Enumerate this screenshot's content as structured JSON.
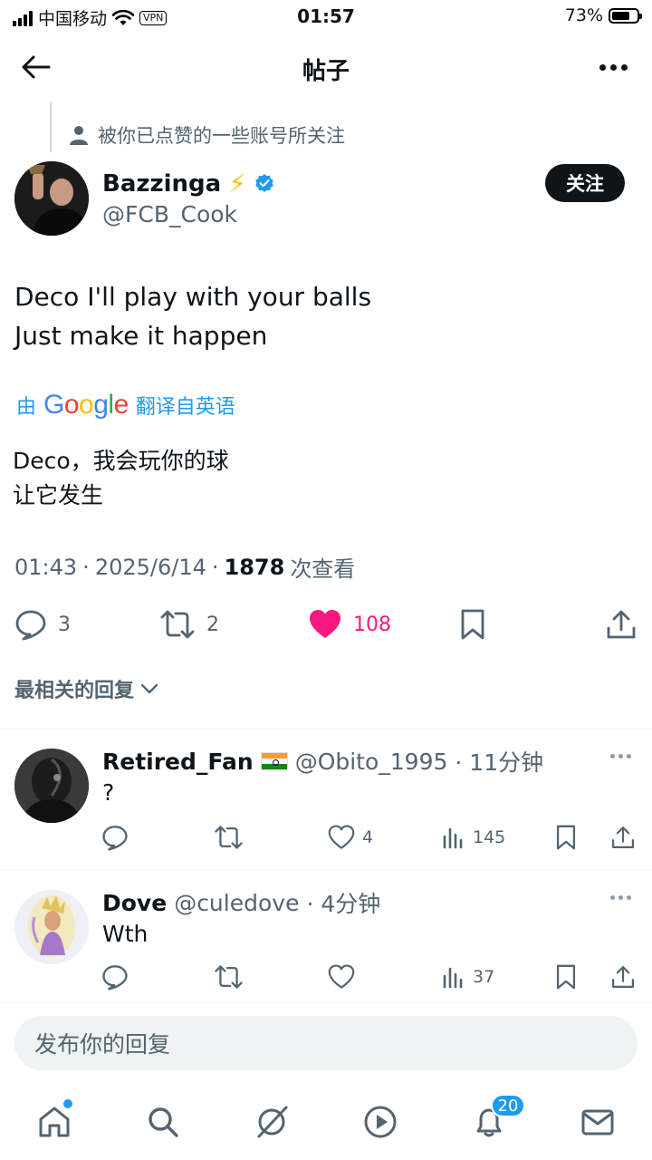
{
  "status_bar": {
    "carrier": "中国移动",
    "vpn": "VPN",
    "time": "01:57",
    "battery": "73%",
    "battery_level": 0.73
  },
  "header": {
    "title": "帖子"
  },
  "post": {
    "social_context": "被你已点赞的一些账号所关注",
    "author_name": "Bazzinga",
    "author_emoji": "⚡",
    "author_handle": "@FCB_Cook",
    "follow_label": "关注",
    "text_line1": "Deco I'll play with your balls",
    "text_line2": "Just make it happen",
    "translate_prefix": "由",
    "translate_brand": [
      "G",
      "o",
      "o",
      "g",
      "l",
      "e"
    ],
    "translate_suffix": "翻译自英语",
    "translated_line1": "Deco，我会玩你的球",
    "translated_line2": "让它发生",
    "time": "01:43",
    "sep1": "·",
    "date": "2025/6/14",
    "sep2": "·",
    "views": "1878",
    "views_label": "次查看",
    "replies": "3",
    "reposts": "2",
    "likes": "108"
  },
  "sort_label": "最相关的回复",
  "replies": [
    {
      "name": "Retired_Fan",
      "handle": "@Obito_1995",
      "time": "· 11分钟",
      "text": "?",
      "likes": "4",
      "views": "145"
    },
    {
      "name": "Dove",
      "handle": "@culedove",
      "time": "· 4分钟",
      "text": "Wth",
      "likes": "",
      "views": "37"
    }
  ],
  "composer_placeholder": "发布你的回复",
  "nav": {
    "notifications_badge": "20"
  },
  "colors": {
    "accent": "#1d9bf0",
    "like": "#f91880",
    "text_secondary": "#536471"
  }
}
